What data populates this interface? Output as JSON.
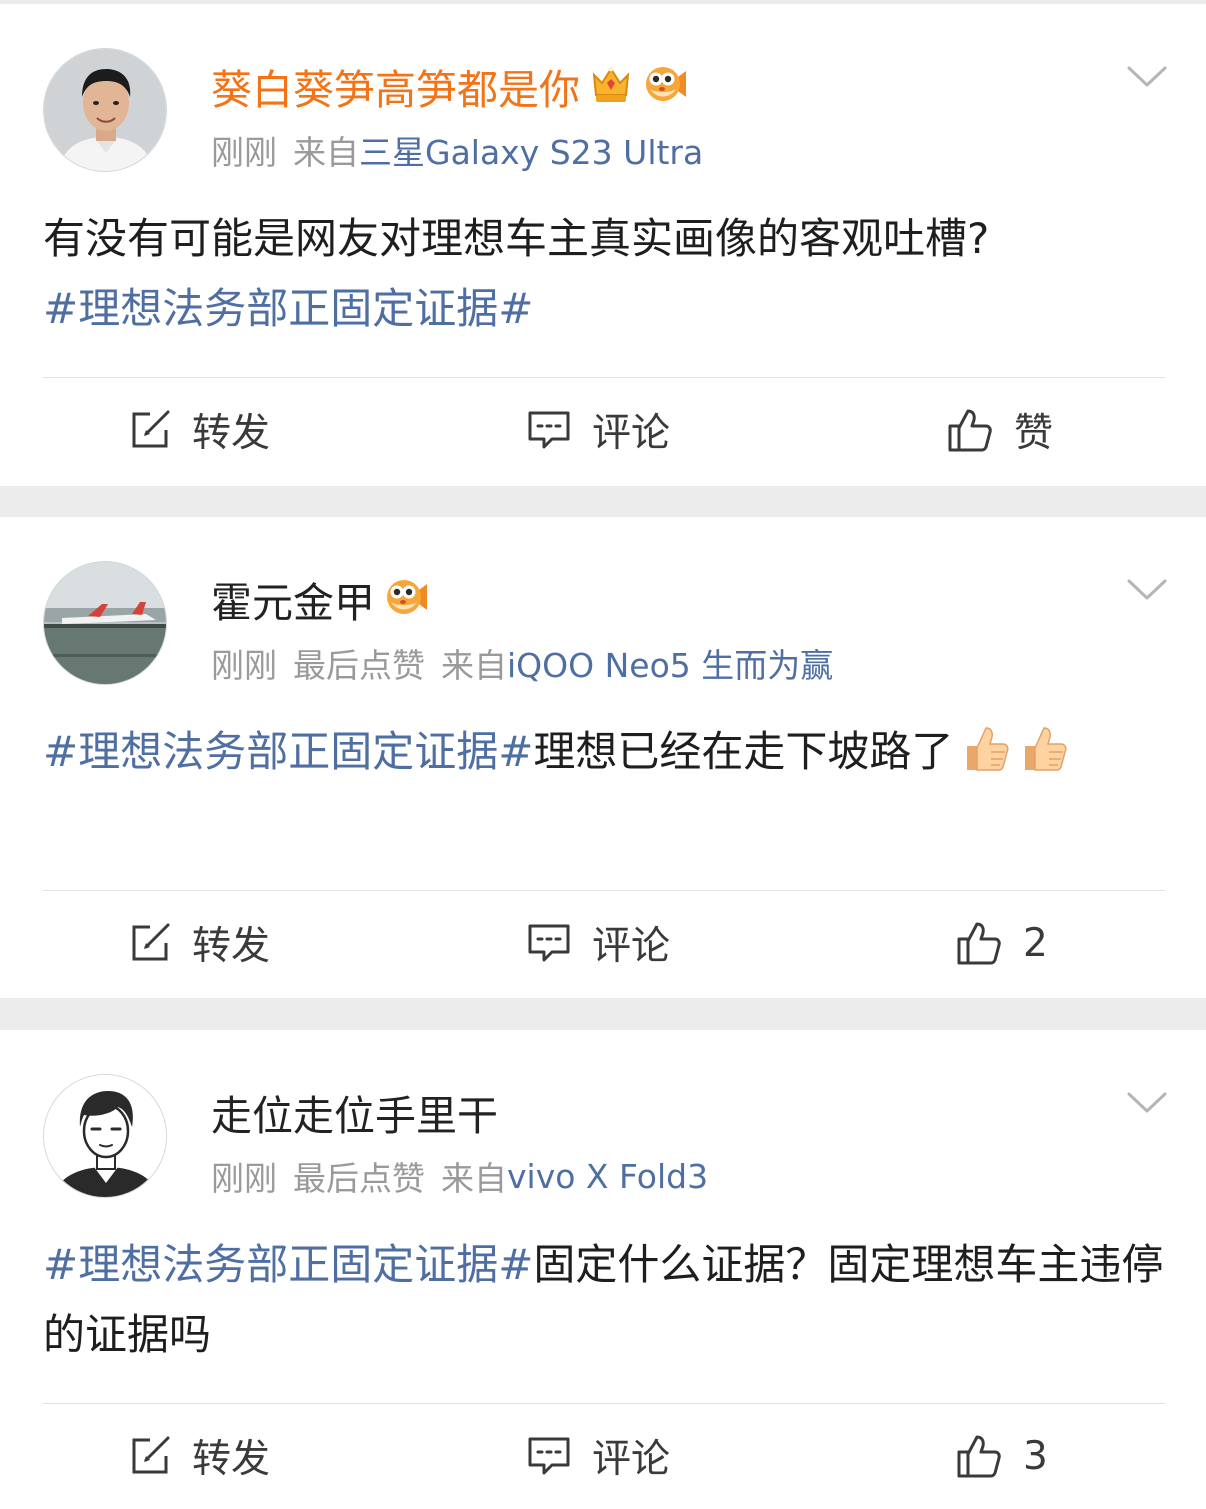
{
  "posts": [
    {
      "user": {
        "name": "葵白葵笋高笋都是你",
        "is_vip": true,
        "badges": [
          "crown-icon",
          "pufferfish-icon"
        ]
      },
      "meta": {
        "time": "刚刚",
        "last_like": "",
        "source_prefix": "来自",
        "device": "三星Galaxy S23 Ultra"
      },
      "content": {
        "text": "有没有可能是网友对理想车主真实画像的客观吐槽?",
        "topic": "#理想法务部正固定证据#",
        "emoji": []
      },
      "actions": {
        "repost": "转发",
        "comment": "评论",
        "like": "赞"
      }
    },
    {
      "user": {
        "name": "霍元金甲",
        "is_vip": false,
        "badges": [
          "pufferfish-icon"
        ]
      },
      "meta": {
        "time": "刚刚",
        "last_like": "最后点赞",
        "source_prefix": "来自",
        "device": "iQOO Neo5 生而为赢"
      },
      "content": {
        "topic": "#理想法务部正固定证据#",
        "text": "理想已经在走下坡路了",
        "emoji": [
          "thumbs-up-emoji",
          "thumbs-up-emoji"
        ]
      },
      "actions": {
        "repost": "转发",
        "comment": "评论",
        "like": "2"
      }
    },
    {
      "user": {
        "name": "走位走位手里干",
        "is_vip": false,
        "badges": []
      },
      "meta": {
        "time": "刚刚",
        "last_like": "最后点赞",
        "source_prefix": "来自",
        "device": "vivo X Fold3"
      },
      "content": {
        "topic": "#理想法务部正固定证据#",
        "text": "固定什么证据？固定理想车主违停的证据吗",
        "emoji": []
      },
      "actions": {
        "repost": "转发",
        "comment": "评论",
        "like": "3"
      }
    }
  ],
  "colors": {
    "vip_name": "#f37317",
    "topic_link": "#4f6fa3",
    "meta_gray": "#9a9a9a",
    "separator": "#ececec"
  }
}
